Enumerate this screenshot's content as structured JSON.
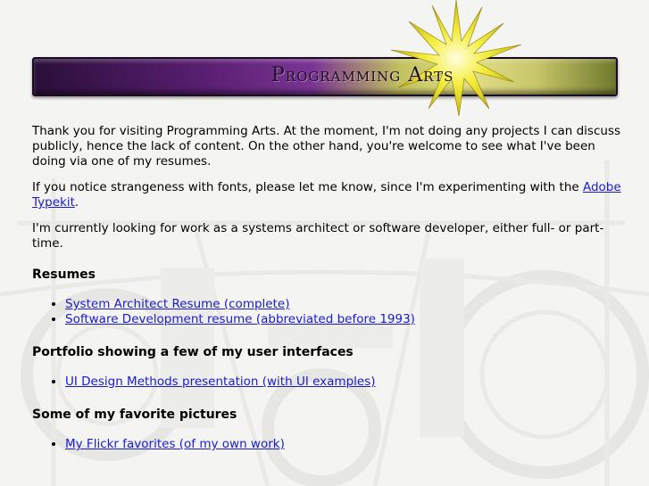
{
  "banner": {
    "title": "Programming Arts"
  },
  "intro": {
    "para1": "Thank you for visiting Programming Arts. At the moment, I'm not doing any projects I can discuss publicly, hence the lack of content. On the other hand, you're welcome to see what I've been doing via one of my resumes.",
    "para2_before": "If you notice strangeness with fonts, please let me know, since I'm experimenting with the ",
    "para2_link": "Adobe Typekit",
    "para2_after": ".",
    "para3": "I'm currently looking for work as a systems architect or software developer, either full- or part-time."
  },
  "sections": {
    "resumes": {
      "heading": "Resumes",
      "links": [
        "System Architect Resume (complete)",
        "Software Development resume (abbreviated before 1993)"
      ]
    },
    "portfolio": {
      "heading": "Portfolio showing a few of my user interfaces",
      "links": [
        "UI Design Methods presentation (with UI examples)"
      ]
    },
    "pictures": {
      "heading": "Some of my favorite pictures",
      "links": [
        "My Flickr favorites (of my own work)"
      ]
    }
  },
  "colors": {
    "link": "#1a1ad0",
    "banner_purple": "#5a1f72",
    "banner_gold": "#e2de8a",
    "star": "#f2ea1a"
  }
}
